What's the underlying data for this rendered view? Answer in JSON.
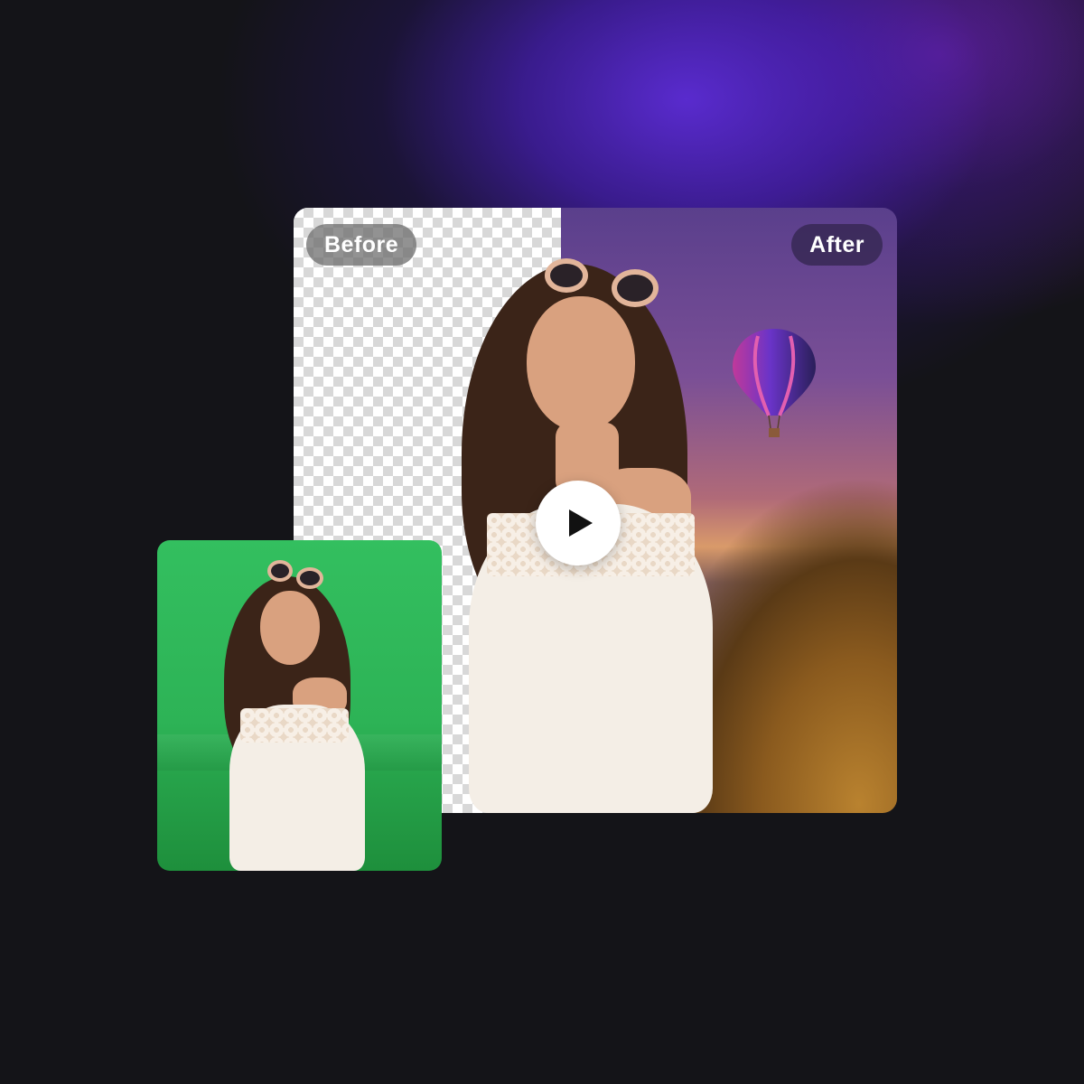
{
  "comparison": {
    "before_label": "Before",
    "after_label": "After"
  },
  "icons": {
    "play": "play-icon"
  },
  "colors": {
    "background": "#141418",
    "glow_purple": "#5c2cd6",
    "green_screen": "#2db356",
    "checker": "#d8d8d8"
  }
}
